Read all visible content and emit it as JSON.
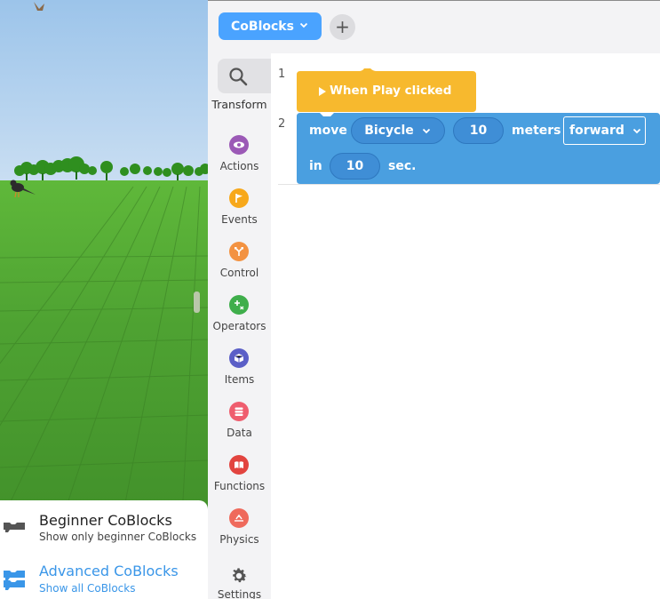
{
  "editor": {
    "active_tab_label": "CoBlocks",
    "add_tab_label": "+"
  },
  "categories": [
    {
      "label": "Transform",
      "icon": "search-icon",
      "color": "#555555"
    },
    {
      "label": "Actions",
      "icon": "eye-icon",
      "color": "#9b59b6"
    },
    {
      "label": "Events",
      "icon": "flag-icon",
      "color": "#f7a81b"
    },
    {
      "label": "Control",
      "icon": "branch-icon",
      "color": "#f39241"
    },
    {
      "label": "Operators",
      "icon": "plus-minus-icon",
      "color": "#3fae4b"
    },
    {
      "label": "Items",
      "icon": "cube-icon",
      "color": "#5b5fc7"
    },
    {
      "label": "Data",
      "icon": "database-icon",
      "color": "#ef5d6e"
    },
    {
      "label": "Functions",
      "icon": "book-icon",
      "color": "#e2443f"
    },
    {
      "label": "Physics",
      "icon": "physics-icon",
      "color": "#ef6a5c"
    }
  ],
  "settings": {
    "label": "Settings",
    "icon": "gear-icon"
  },
  "code": {
    "line_numbers": [
      "1",
      "2"
    ],
    "hat_block": {
      "label": "When Play clicked",
      "color": "#f7b92e"
    },
    "move_block": {
      "color": "#4a9fe0",
      "keyword_move": "move",
      "item": "Bicycle",
      "distance": "10",
      "unit": "meters",
      "direction": "forward",
      "keyword_in": "in",
      "duration": "10",
      "time_unit": "sec."
    }
  },
  "mode_menu": {
    "options": [
      {
        "title": "Beginner CoBlocks",
        "subtitle": "Show only beginner CoBlocks",
        "color": "#222222",
        "subtitle_color": "#444444",
        "icon": "beginner-block-icon"
      },
      {
        "title": "Advanced CoBlocks",
        "subtitle": "Show all CoBlocks",
        "color": "#3a96e8",
        "subtitle_color": "#3a96e8",
        "icon": "advanced-blocks-icon"
      }
    ]
  },
  "colors": {
    "accent": "#4aa3ff",
    "panel_bg": "#f3f3f5",
    "grass": "#49a02f",
    "sky": "#a9ccec"
  }
}
